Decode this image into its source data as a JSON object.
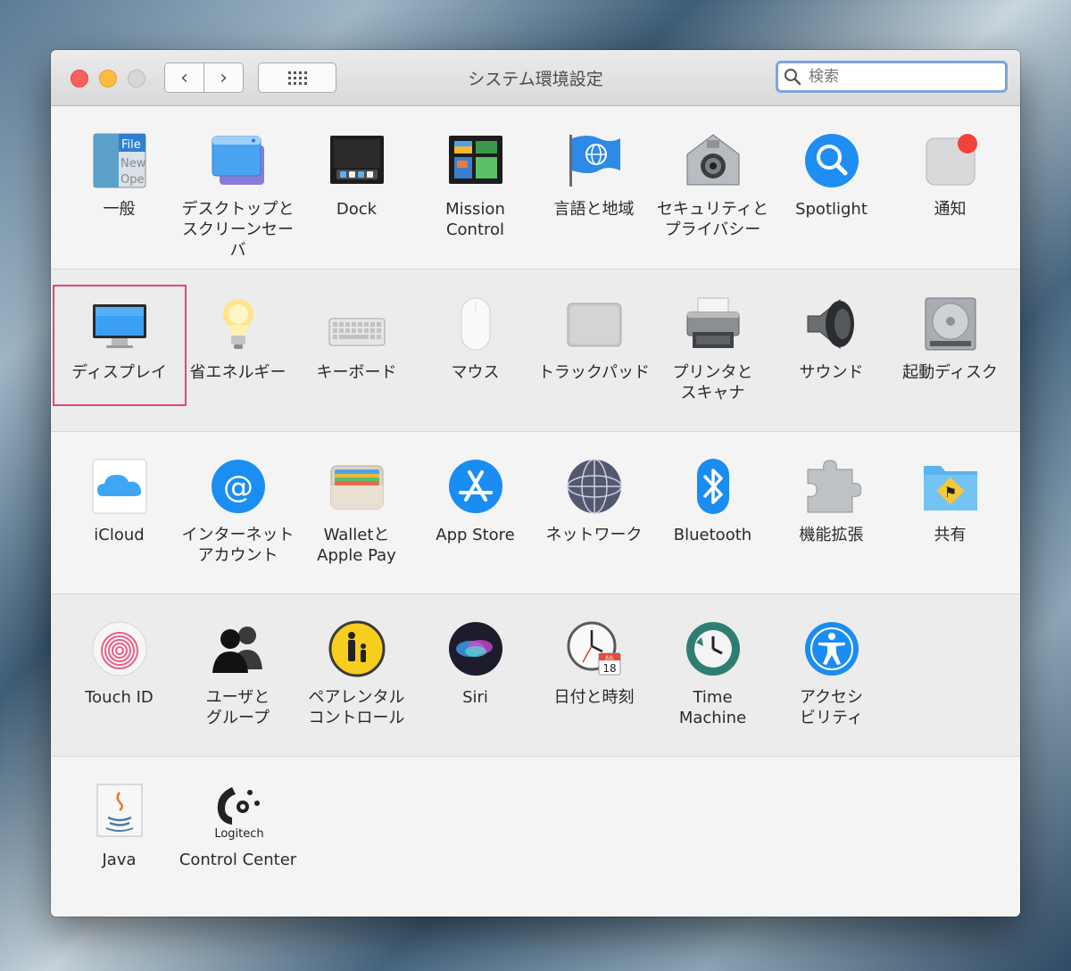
{
  "window": {
    "title": "システム環境設定",
    "search_placeholder": "検索",
    "back_glyph": "‹",
    "forward_glyph": "›"
  },
  "rows": [
    [
      {
        "label": "一般",
        "icon": "general-icon"
      },
      {
        "label": "デスクトップと\nスクリーンセーバ",
        "icon": "desktop-screensaver-icon"
      },
      {
        "label": "Dock",
        "icon": "dock-icon"
      },
      {
        "label": "Mission\nControl",
        "icon": "mission-control-icon"
      },
      {
        "label": "言語と地域",
        "icon": "language-region-icon"
      },
      {
        "label": "セキュリティと\nプライバシー",
        "icon": "security-privacy-icon"
      },
      {
        "label": "Spotlight",
        "icon": "spotlight-icon"
      },
      {
        "label": "通知",
        "icon": "notifications-icon"
      }
    ],
    [
      {
        "label": "ディスプレイ",
        "icon": "display-icon",
        "selected": true
      },
      {
        "label": "省エネルギー",
        "icon": "energy-saver-icon"
      },
      {
        "label": "キーボード",
        "icon": "keyboard-icon"
      },
      {
        "label": "マウス",
        "icon": "mouse-icon"
      },
      {
        "label": "トラックパッド",
        "icon": "trackpad-icon"
      },
      {
        "label": "プリンタと\nスキャナ",
        "icon": "printer-scanner-icon"
      },
      {
        "label": "サウンド",
        "icon": "sound-icon"
      },
      {
        "label": "起動ディスク",
        "icon": "startup-disk-icon"
      }
    ],
    [
      {
        "label": "iCloud",
        "icon": "icloud-icon"
      },
      {
        "label": "インターネット\nアカウント",
        "icon": "internet-accounts-icon"
      },
      {
        "label": "Walletと\nApple Pay",
        "icon": "wallet-icon"
      },
      {
        "label": "App Store",
        "icon": "app-store-icon"
      },
      {
        "label": "ネットワーク",
        "icon": "network-icon"
      },
      {
        "label": "Bluetooth",
        "icon": "bluetooth-icon"
      },
      {
        "label": "機能拡張",
        "icon": "extensions-icon"
      },
      {
        "label": "共有",
        "icon": "sharing-icon"
      }
    ],
    [
      {
        "label": "Touch ID",
        "icon": "touch-id-icon"
      },
      {
        "label": "ユーザと\nグループ",
        "icon": "users-groups-icon"
      },
      {
        "label": "ペアレンタル\nコントロール",
        "icon": "parental-controls-icon"
      },
      {
        "label": "Siri",
        "icon": "siri-icon"
      },
      {
        "label": "日付と時刻",
        "icon": "date-time-icon"
      },
      {
        "label": "Time\nMachine",
        "icon": "time-machine-icon"
      },
      {
        "label": "アクセシ\nビリティ",
        "icon": "accessibility-icon"
      }
    ],
    [
      {
        "label": "Java",
        "icon": "java-icon"
      },
      {
        "label": "Control Center",
        "icon": "logitech-icon"
      }
    ]
  ],
  "icon_text": {
    "general_file": "File",
    "general_new": "New",
    "general_open": "Ope",
    "calendar_month": "JUL",
    "calendar_day": "18",
    "logitech": "Logitech"
  },
  "colors": {
    "highlight": "#e8457a",
    "close": "#fc605c",
    "minimize": "#fdbc40"
  }
}
